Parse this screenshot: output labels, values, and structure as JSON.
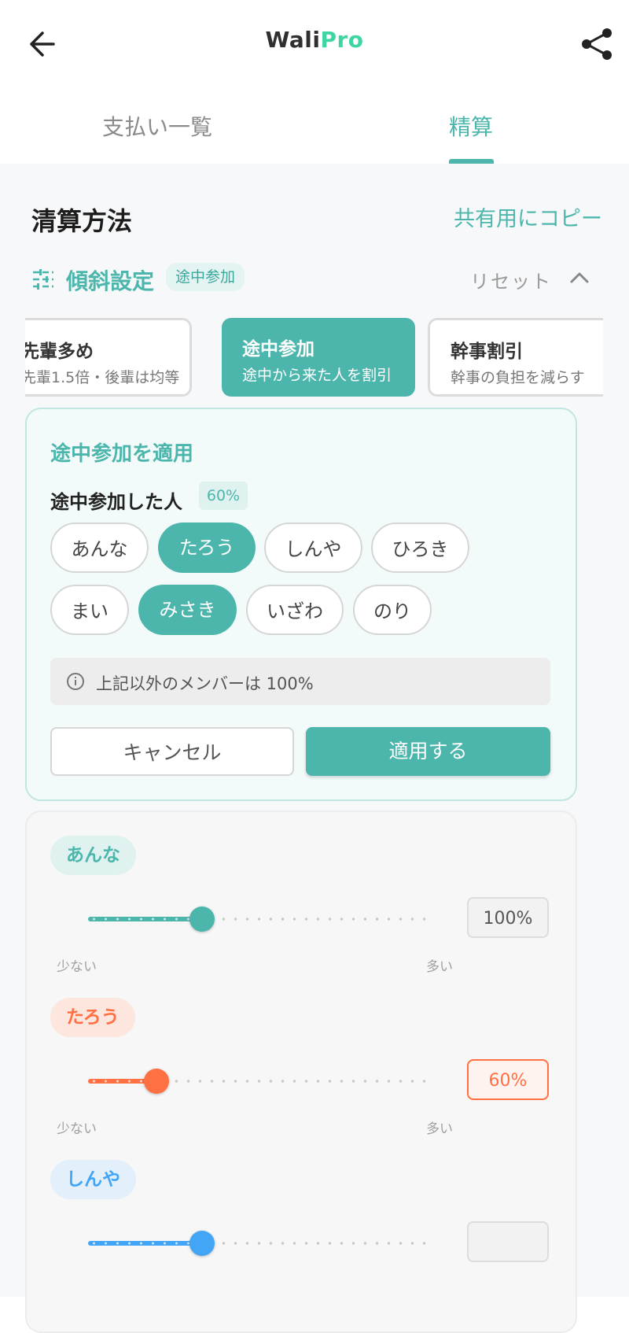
{
  "header": {
    "title_main": "Wali",
    "title_accent": "Pro",
    "back_icon": "arrow-left-icon",
    "share_icon": "share-icon"
  },
  "tabs": [
    {
      "label": "支払い一覧",
      "active": false
    },
    {
      "label": "精算",
      "active": true
    }
  ],
  "section": {
    "title": "清算方法",
    "copy_label": "共有用にコピー"
  },
  "gradient": {
    "title": "傾斜設定",
    "badge": "途中参加",
    "reset_label": "リセット",
    "icon": "sliders-icon",
    "collapse_icon": "chevron-up-icon"
  },
  "presets": [
    {
      "title": "先輩多め",
      "subtitle": "先輩1.5倍・後輩は均等",
      "selected": false
    },
    {
      "title": "途中参加",
      "subtitle": "途中から来た人を割引",
      "selected": true
    },
    {
      "title": "幹事割引",
      "subtitle": "幹事の負担を減らす",
      "selected": false
    }
  ],
  "apply_panel": {
    "title": "途中参加を適用",
    "subtitle": "途中参加した人",
    "percent": "60%",
    "people": [
      {
        "name": "あんな",
        "selected": false
      },
      {
        "name": "たろう",
        "selected": true
      },
      {
        "name": "しんや",
        "selected": false
      },
      {
        "name": "ひろき",
        "selected": false
      },
      {
        "name": "まい",
        "selected": false
      },
      {
        "name": "みさき",
        "selected": true
      },
      {
        "name": "いざわ",
        "selected": false
      },
      {
        "name": "のり",
        "selected": false
      }
    ],
    "note": "上記以外のメンバーは 100%",
    "cancel_label": "キャンセル",
    "apply_label": "適用する"
  },
  "members": [
    {
      "name": "あんな",
      "value": 100,
      "display": "100%",
      "color": "#4db6ac",
      "bg": "#e0f2ef",
      "box_border": "#dddddd",
      "box_bg": "#f2f2f2",
      "box_color": "#555555",
      "min_label": "少ない",
      "max_label": "多い"
    },
    {
      "name": "たろう",
      "value": 60,
      "display": "60%",
      "color": "#ff7043",
      "bg": "#fde6de",
      "box_border": "#ff7043",
      "box_bg": "#fff3ef",
      "box_color": "#ff7043",
      "min_label": "少ない",
      "max_label": "多い"
    },
    {
      "name": "しんや",
      "value": 100,
      "display": "",
      "color": "#42a5f5",
      "bg": "#e3f0fb",
      "box_border": "#dddddd",
      "box_bg": "#f2f2f2",
      "box_color": "#555555",
      "min_label": "少ない",
      "max_label": "多い"
    }
  ],
  "colors": {
    "accent": "#4db6ac",
    "orange": "#ff7043",
    "blue": "#42a5f5"
  }
}
